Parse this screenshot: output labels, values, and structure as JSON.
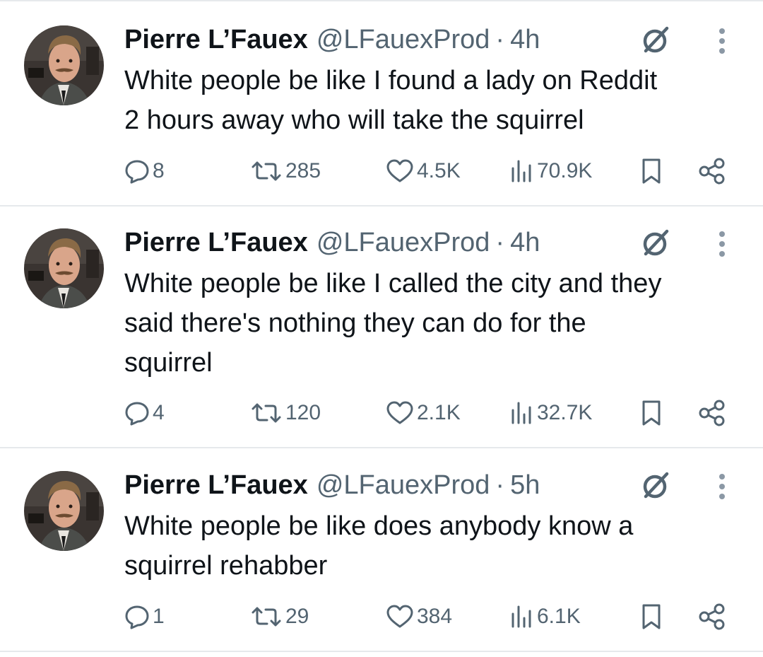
{
  "tweets": [
    {
      "author_name": "Pierre L’Fauex",
      "handle": "@LFauexProd",
      "separator": "·",
      "time": "4h",
      "text": "White people be like I found a lady on Reddit\n2 hours away who will take the squirrel",
      "replies": "8",
      "retweets": "285",
      "likes": "4.5K",
      "views": "70.9K"
    },
    {
      "author_name": "Pierre L’Fauex",
      "handle": "@LFauexProd",
      "separator": "·",
      "time": "4h",
      "text": "White people be like I called the city and they\nsaid there's nothing they can do for the\nsquirrel",
      "replies": "4",
      "retweets": "120",
      "likes": "2.1K",
      "views": "32.7K"
    },
    {
      "author_name": "Pierre L’Fauex",
      "handle": "@LFauexProd",
      "separator": "·",
      "time": "5h",
      "text": "White people be like does anybody know a\nsquirrel rehabber",
      "replies": "1",
      "retweets": "29",
      "likes": "384",
      "views": "6.1K"
    }
  ],
  "icons": {
    "reply": "reply-icon",
    "retweet": "retweet-icon",
    "like": "heart-icon",
    "views": "views-bar-icon",
    "bookmark": "bookmark-icon",
    "share": "share-icon",
    "grok": "grok-icon",
    "more": "more-dots-icon"
  },
  "colors": {
    "text": "#0f1419",
    "secondary": "#536471",
    "divider": "#e6e9ec",
    "background": "#ffffff"
  }
}
